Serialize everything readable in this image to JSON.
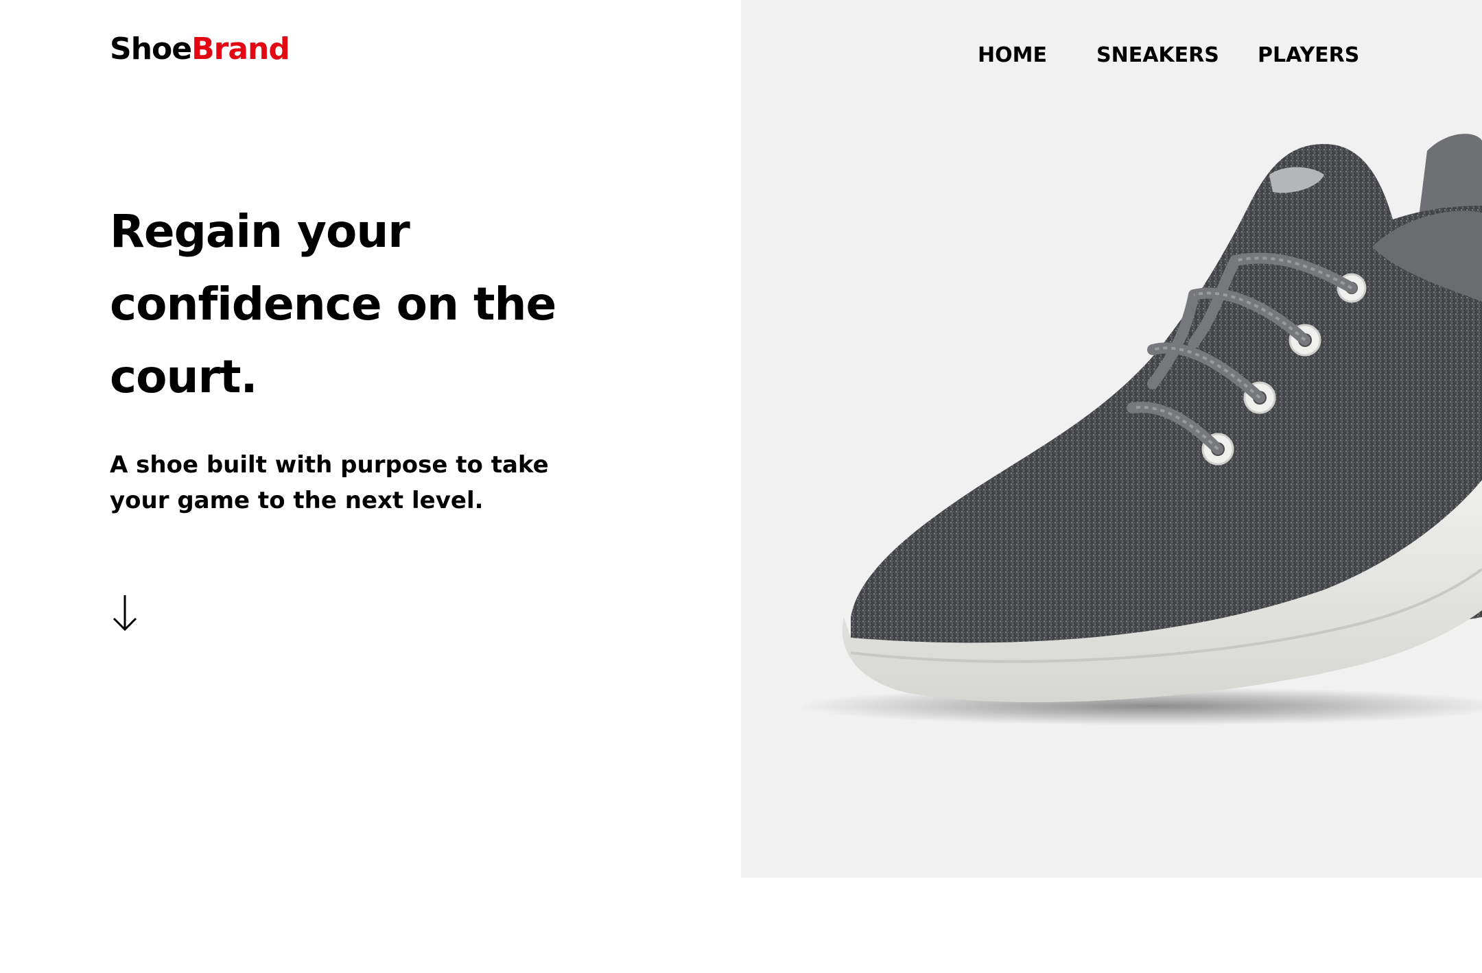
{
  "brand": {
    "part1": "Shoe",
    "part2": "Brand",
    "accent_color": "#e30613"
  },
  "nav": {
    "items": [
      {
        "label": "HOME"
      },
      {
        "label": "SNEAKERS"
      },
      {
        "label": "PLAYERS"
      }
    ]
  },
  "hero": {
    "headline": "Regain your confidence on the court.",
    "subtitle": "A shoe built with purpose to take your game to the next level.",
    "scroll_icon": "arrow-down-icon",
    "image": "gray-wool-sneaker",
    "panel_color": "#f1f1f1"
  }
}
